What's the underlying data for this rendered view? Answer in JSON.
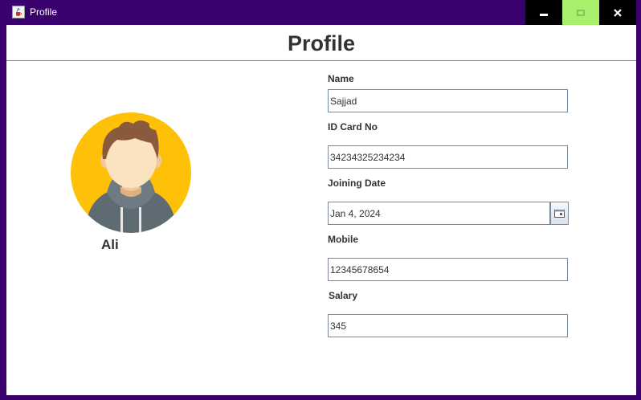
{
  "window": {
    "title": "Profile"
  },
  "page": {
    "heading": "Profile"
  },
  "profile": {
    "name": "Ali"
  },
  "form": {
    "name": {
      "label": "Name",
      "value": "Sajjad"
    },
    "id_card": {
      "label": "ID Card No",
      "value": "34234325234234"
    },
    "joining_date": {
      "label": "Joining Date",
      "value": "Jan 4, 2024"
    },
    "mobile": {
      "label": "Mobile",
      "value": "12345678654"
    },
    "salary": {
      "label": "Salary",
      "value": "345"
    }
  },
  "colors": {
    "window_frame": "#3a006e",
    "maximize_button": "#a8f06c",
    "avatar_background": "#ffc107",
    "text": "#333333"
  },
  "icons": {
    "app": "java-cup-icon",
    "minimize": "minimize-icon",
    "maximize": "maximize-icon",
    "close": "close-icon",
    "calendar": "calendar-icon",
    "avatar": "user-avatar-icon"
  }
}
